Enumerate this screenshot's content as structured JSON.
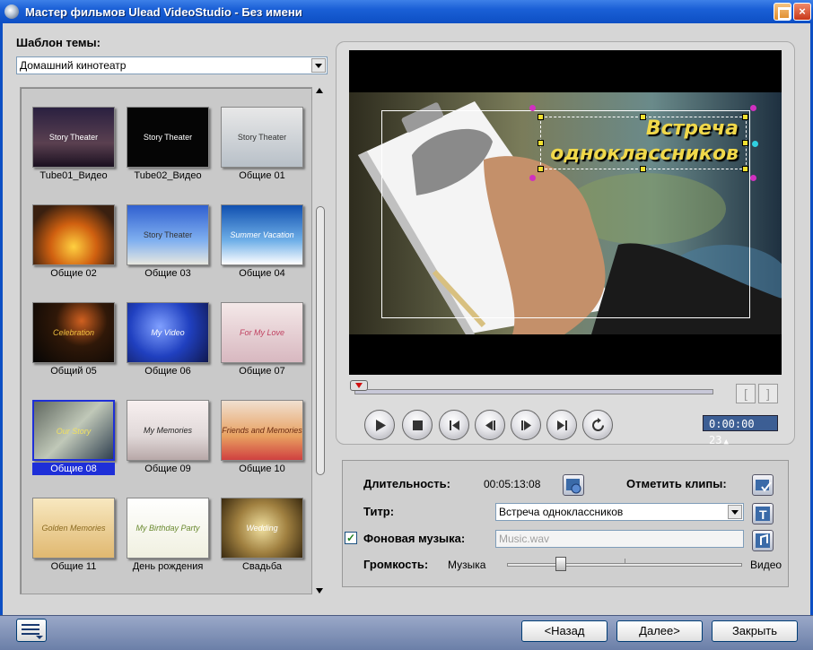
{
  "window": {
    "title": "Мастер фильмов Ulead VideoStudio - Без имени"
  },
  "theme": {
    "label": "Шаблон темы:",
    "selected": "Домашний кинотеатр"
  },
  "thumbnails": [
    {
      "caption": "Tube01_Видео",
      "img_text": "Story Theater"
    },
    {
      "caption": "Tube02_Видео",
      "img_text": "Story Theater"
    },
    {
      "caption": "Общие 01",
      "img_text": "Story Theater"
    },
    {
      "caption": "Общие 02",
      "img_text": ""
    },
    {
      "caption": "Общие 03",
      "img_text": "Story Theater"
    },
    {
      "caption": "Общие 04",
      "img_text": "Summer Vacation"
    },
    {
      "caption": "Общий 05",
      "img_text": "Celebration"
    },
    {
      "caption": "Общие 06",
      "img_text": "My Video"
    },
    {
      "caption": "Общие 07",
      "img_text": "For My Love"
    },
    {
      "caption": "Общие 08",
      "img_text": "Our Story"
    },
    {
      "caption": "Общие 09",
      "img_text": "My Memories"
    },
    {
      "caption": "Общие 10",
      "img_text": "Friends and Memories"
    },
    {
      "caption": "Общие 11",
      "img_text": "Golden Memories"
    },
    {
      "caption": "День рождения",
      "img_text": "My Birthday Party"
    },
    {
      "caption": "Свадьба",
      "img_text": "Wedding"
    }
  ],
  "preview": {
    "title_line1": "Встреча",
    "title_line2": "одноклассников",
    "timecode": "0:00:00 23",
    "mark_in": "[",
    "mark_out": "]"
  },
  "settings": {
    "duration_label": "Длительность:",
    "duration_value": "00:05:13:08",
    "mark_clips_label": "Отметить клипы:",
    "title_label": "Титр:",
    "title_value": "Встреча одноклассников",
    "music_label": "Фоновая музыка:",
    "music_value": "Music.wav",
    "music_checked": "✓",
    "volume_label": "Громкость:",
    "volume_left": "Музыка",
    "volume_right": "Видео",
    "volume_level": 0.23
  },
  "footer": {
    "back_label": "<Назад",
    "next_label": "Далее>",
    "close_label": "Закрыть"
  }
}
